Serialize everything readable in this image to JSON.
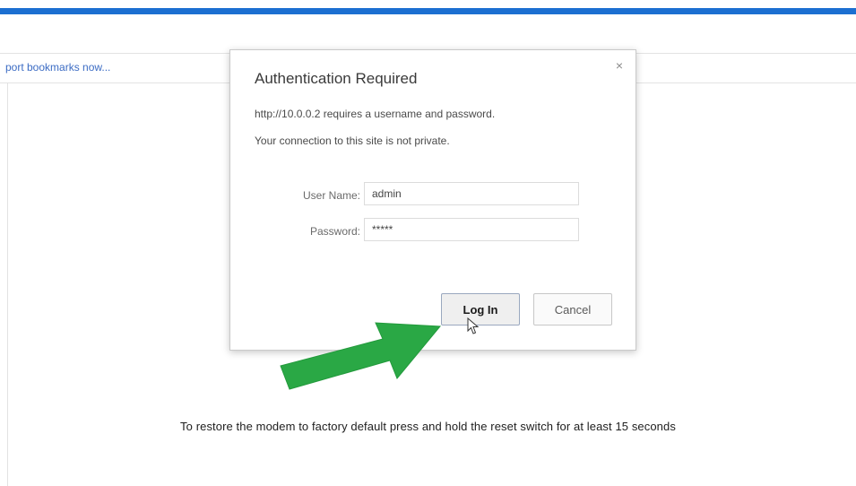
{
  "browser": {
    "accent_color": "#1c6fd1",
    "bookmarks_link": "port bookmarks now..."
  },
  "page": {
    "message": "To restore the modem to factory default press and hold the reset switch for at least 15 seconds"
  },
  "dialog": {
    "title": "Authentication Required",
    "close_icon": "close-icon",
    "line1": "http://10.0.0.2 requires a username and password.",
    "line2": "Your connection to this site is not private.",
    "username_label": "User Name:",
    "username_value": "admin",
    "password_label": "Password:",
    "password_value": "*****",
    "login_label": "Log In",
    "cancel_label": "Cancel"
  },
  "annotation": {
    "arrow_color": "#2aa845",
    "cursor_icon": "mouse-pointer-icon"
  }
}
